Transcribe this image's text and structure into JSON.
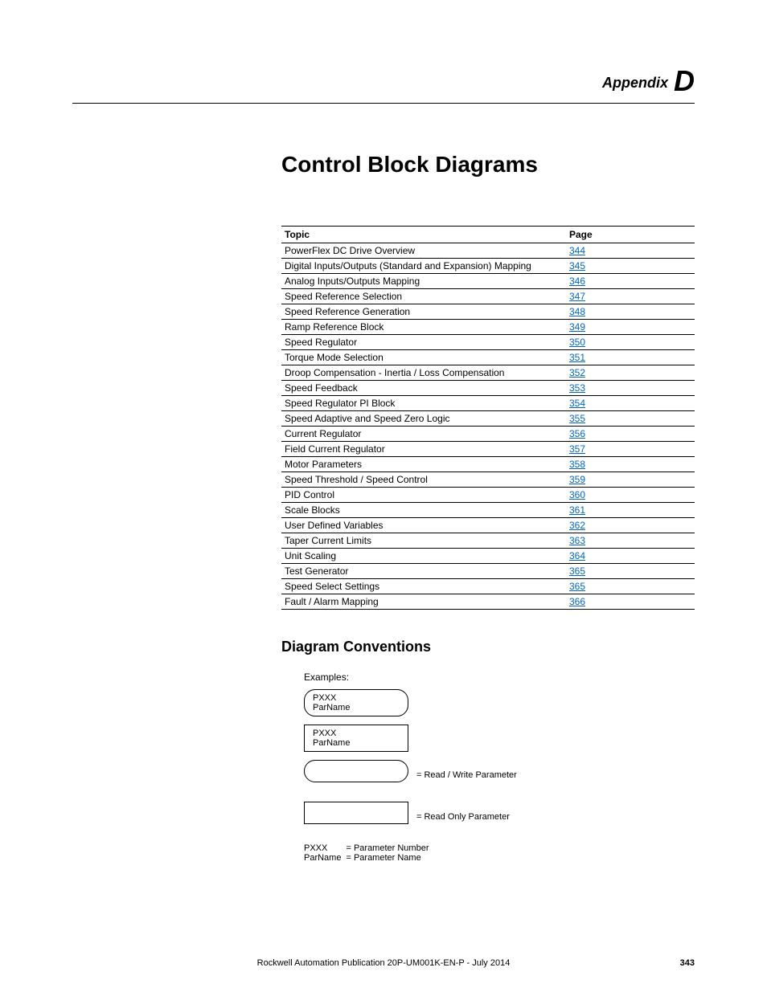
{
  "header": {
    "appendix_label": "Appendix",
    "appendix_letter": "D"
  },
  "chapter_title": "Control Block Diagrams",
  "toc": {
    "col_topic": "Topic",
    "col_page": "Page",
    "rows": [
      {
        "topic": "PowerFlex DC Drive Overview",
        "page": "344"
      },
      {
        "topic": "Digital Inputs/Outputs (Standard and Expansion) Mapping",
        "page": "345"
      },
      {
        "topic": "Analog Inputs/Outputs Mapping",
        "page": "346"
      },
      {
        "topic": "Speed Reference Selection",
        "page": "347"
      },
      {
        "topic": "Speed Reference Generation",
        "page": "348"
      },
      {
        "topic": "Ramp Reference Block",
        "page": "349"
      },
      {
        "topic": "Speed Regulator",
        "page": "350"
      },
      {
        "topic": "Torque Mode Selection",
        "page": "351"
      },
      {
        "topic": "Droop Compensation - Inertia / Loss Compensation",
        "page": "352"
      },
      {
        "topic": "Speed Feedback",
        "page": "353"
      },
      {
        "topic": "Speed Regulator PI Block",
        "page": "354"
      },
      {
        "topic": "Speed Adaptive and Speed Zero Logic",
        "page": "355"
      },
      {
        "topic": "Current Regulator",
        "page": "356"
      },
      {
        "topic": "Field Current Regulator",
        "page": "357"
      },
      {
        "topic": "Motor Parameters",
        "page": "358"
      },
      {
        "topic": "Speed Threshold / Speed Control",
        "page": "359"
      },
      {
        "topic": "PID Control",
        "page": "360"
      },
      {
        "topic": "Scale Blocks",
        "page": "361"
      },
      {
        "topic": "User Defined Variables",
        "page": "362"
      },
      {
        "topic": "Taper Current Limits",
        "page": "363"
      },
      {
        "topic": "Unit Scaling",
        "page": "364"
      },
      {
        "topic": "Test Generator",
        "page": "365"
      },
      {
        "topic": "Speed Select Settings",
        "page": "365"
      },
      {
        "topic": "Fault / Alarm Mapping",
        "page": "366"
      }
    ]
  },
  "conventions": {
    "title": "Diagram Conventions",
    "examples_label": "Examples:",
    "pxxx": "PXXX",
    "parname": "ParName",
    "rw_label": "= Read / Write Parameter",
    "ro_label": "= Read Only Parameter",
    "legend_pxxx_key": "PXXX",
    "legend_pxxx_val": "= Parameter Number",
    "legend_parname_key": "ParName",
    "legend_parname_val": "= Parameter Name"
  },
  "footer": {
    "text": "Rockwell Automation Publication 20P-UM001K-EN-P - July 2014",
    "page_number": "343"
  }
}
